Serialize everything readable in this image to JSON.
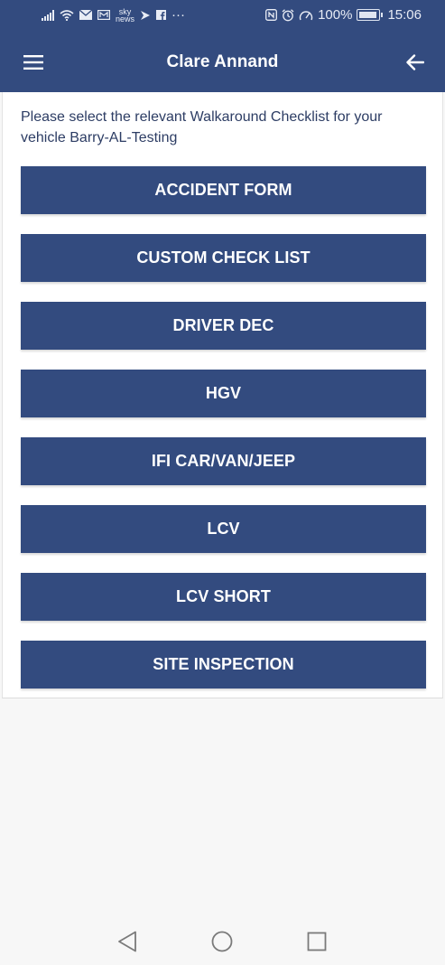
{
  "status_bar": {
    "battery": "100%",
    "time": "15:06",
    "sky_line1": "sky",
    "sky_line2": "news",
    "more": "···",
    "icons_left": [
      "signal-icon",
      "wifi-icon",
      "mail-icon",
      "mail-alt-icon",
      "sky-news-icon",
      "notification-icon",
      "facebook-icon",
      "more-icon"
    ],
    "icons_right": [
      "nfc-icon",
      "alarm-icon",
      "speed-icon",
      "battery-icon"
    ]
  },
  "header": {
    "title": "Clare Annand",
    "menu_icon": "hamburger-menu-icon",
    "back_icon": "back-arrow-icon",
    "background_color": "#334b7f"
  },
  "content": {
    "instruction": "Please select the relevant Walkaround Checklist for your vehicle Barry-AL-Testing"
  },
  "checklists": [
    "ACCIDENT FORM",
    "CUSTOM CHECK LIST",
    "DRIVER DEC",
    "HGV",
    "IFI CAR/VAN/JEEP",
    "LCV",
    "LCV SHORT",
    "SITE INSPECTION"
  ],
  "nav_bar": {
    "back_icon": "nav-back-icon",
    "home_icon": "nav-home-icon",
    "recents_icon": "nav-recents-icon"
  }
}
